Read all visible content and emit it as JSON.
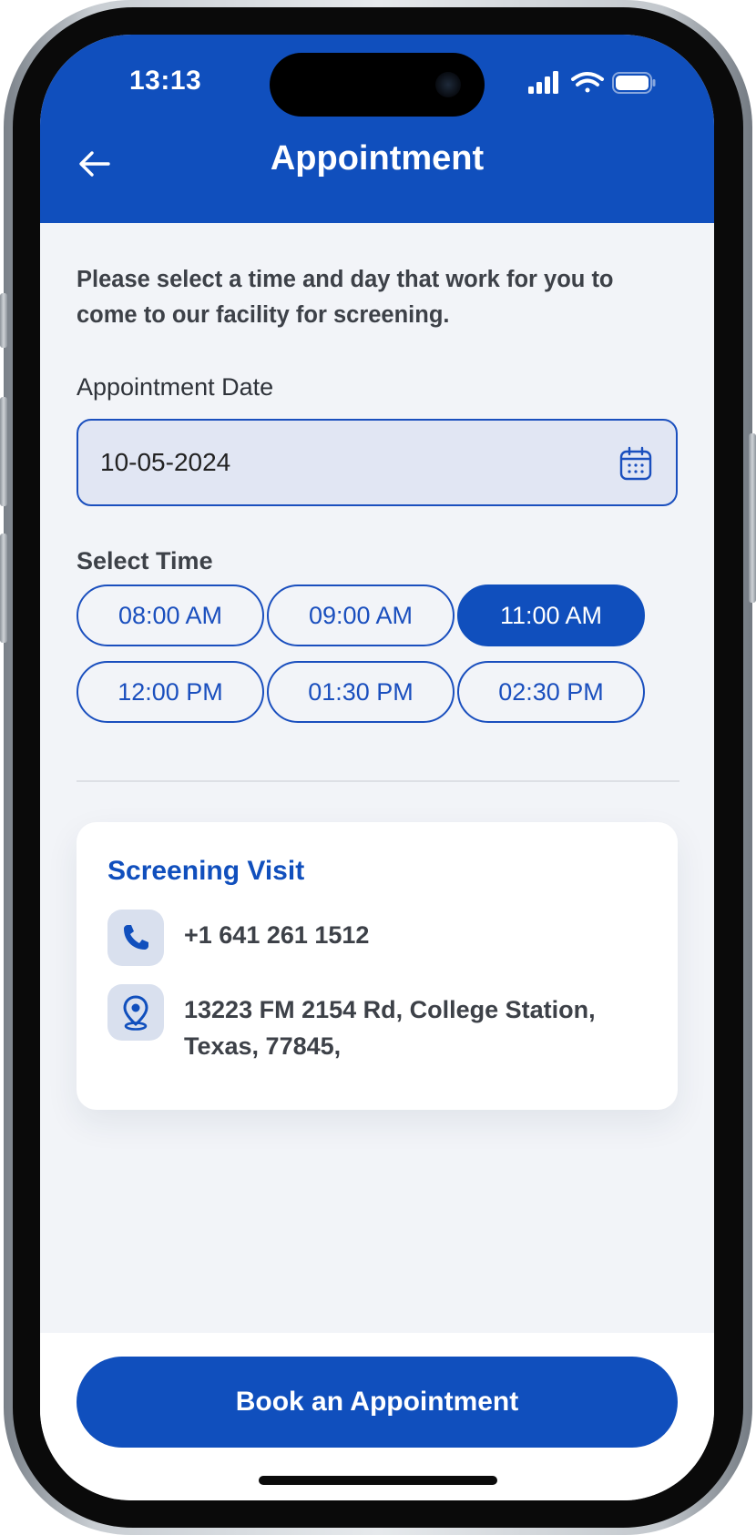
{
  "status_bar": {
    "time": "13:13"
  },
  "header": {
    "title": "Appointment",
    "back_icon": "arrow-left-icon"
  },
  "intro_text": "Please select a time and day that work for you to come to our facility for screening.",
  "date_field": {
    "label": "Appointment Date",
    "value": "10-05-2024",
    "icon": "calendar-icon"
  },
  "time_select": {
    "label": "Select Time",
    "slots": [
      "08:00 AM",
      "09:00 AM",
      "11:00 AM",
      "12:00 PM",
      "01:30 PM",
      "02:30 PM"
    ],
    "selected": "11:00 AM"
  },
  "visit_card": {
    "title": "Screening Visit",
    "phone": "+1 641 261 1512",
    "address": "13223 FM 2154 Rd, College Station, Texas, 77845,",
    "phone_icon": "phone-icon",
    "address_icon": "location-pin-icon"
  },
  "primary_button": {
    "label": "Book an Appointment"
  },
  "colors": {
    "brand_blue": "#104fbd",
    "background": "#f2f4f8",
    "input_fill": "#e1e6f3",
    "text_dark": "#3d4148"
  }
}
